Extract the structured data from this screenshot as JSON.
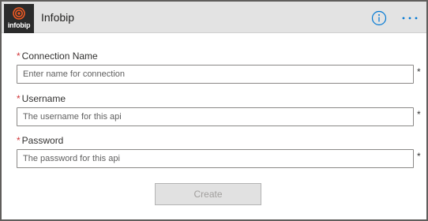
{
  "header": {
    "logo_text": "infobip",
    "title": "Infobip",
    "info_icon": "info-icon",
    "more_icon": "more-horizontal-icon",
    "accent_color": "#0078d4",
    "logo_color": "#f15a22"
  },
  "form": {
    "required_marker": "*",
    "fields": [
      {
        "label": "Connection Name",
        "placeholder": "Enter name for connection"
      },
      {
        "label": "Username",
        "placeholder": "The username for this api"
      },
      {
        "label": "Password",
        "placeholder": "The password for this api"
      }
    ],
    "create_label": "Create"
  }
}
